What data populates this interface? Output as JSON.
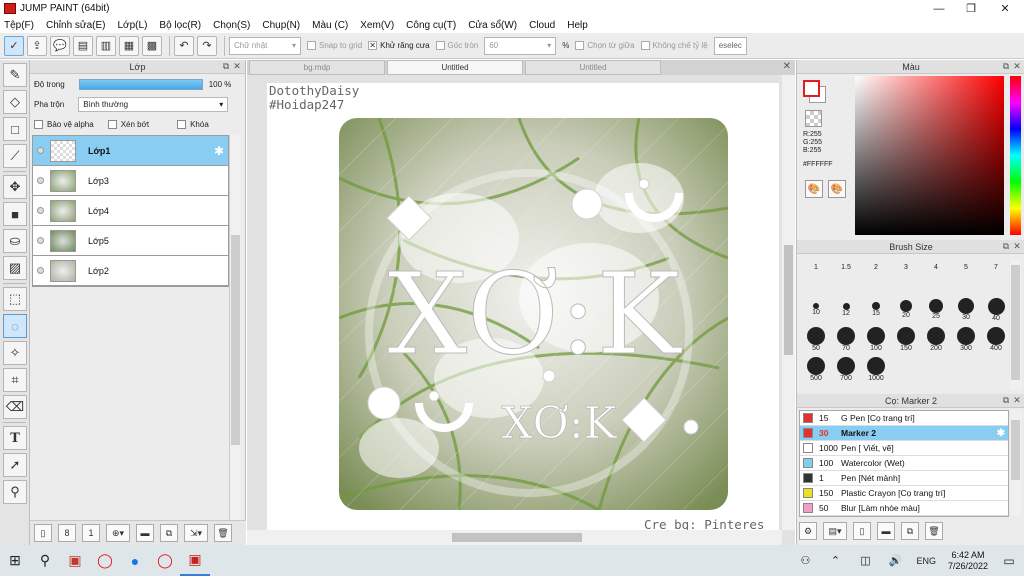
{
  "window": {
    "title": "JUMP PAINT (64bit)",
    "minimize": "—",
    "maximize": "❐",
    "close": "✕"
  },
  "menu": [
    "Tệp(F)",
    "Chỉnh sửa(E)",
    "Lớp(L)",
    "Bộ lọc(R)",
    "Chọn(S)",
    "Chụp(N)",
    "Màu (C)",
    "Xem(V)",
    "Công cụ(T)",
    "Cửa sổ(W)",
    "Cloud",
    "Help"
  ],
  "toolbar": {
    "shape_select": "Chữ nhật",
    "snap_grid": "Snap to grid",
    "antialias": "Khử răng cưa",
    "round_corner": "Góc tròn",
    "round_value": "60",
    "percent": "%",
    "select_center": "Chọn từ giữa",
    "lock_ratio": "Không chế tỷ lệ",
    "deselect": "eselec"
  },
  "layer_panel": {
    "title": "Lớp",
    "opacity_label": "Độ trong",
    "opacity_value": "100 %",
    "opacity": 1.0,
    "blend_label": "Pha trộn",
    "blend_value": "Bình thường",
    "protect_alpha": "Bảo vệ alpha",
    "clipping": "Xén bớt",
    "lock": "Khóa",
    "layers": [
      {
        "name": "Lớp1",
        "active": true
      },
      {
        "name": "Lớp3",
        "active": false
      },
      {
        "name": "Lớp4",
        "active": false
      },
      {
        "name": "Lớp5",
        "active": false
      },
      {
        "name": "Lớp2",
        "active": false
      }
    ]
  },
  "canvas": {
    "tabs": [
      {
        "label": "bg.mdp",
        "active": false
      },
      {
        "label": "Untitled",
        "active": true
      },
      {
        "label": "Untitled",
        "active": false
      }
    ],
    "watermark_line1": "DotothyDaisy",
    "watermark_line2": "#Hoidap247",
    "big_text": "XƠ:K",
    "small_text": "XƠ:K",
    "credit": "Cre bg: Pinteres"
  },
  "color_panel": {
    "title": "Màu",
    "r": "R:255",
    "g": "G:255",
    "b": "B:255",
    "hex": "#FFFFFF"
  },
  "brush_panel": {
    "title": "Brush Size",
    "sizes": [
      "1",
      "1.5",
      "2",
      "3",
      "4",
      "5",
      "7",
      "10",
      "12",
      "15",
      "20",
      "25",
      "30",
      "40",
      "50",
      "70",
      "100",
      "150",
      "200",
      "300",
      "400",
      "500",
      "700",
      "1000"
    ]
  },
  "tool_panel": {
    "title": "Cọ: Marker 2",
    "items": [
      {
        "size": "15",
        "name": "G Pen [Cọ trang trí]",
        "color": "#e03030",
        "active": false
      },
      {
        "size": "30",
        "name": "Marker 2",
        "color": "#e03030",
        "active": true
      },
      {
        "size": "1000",
        "name": "Pen [ Viết, vẽ]",
        "color": "#ffffff",
        "active": false
      },
      {
        "size": "100",
        "name": "Watercolor (Wet)",
        "color": "#7fd0f0",
        "active": false
      },
      {
        "size": "1",
        "name": "Pen [Nét mảnh]",
        "color": "#333333",
        "active": false
      },
      {
        "size": "150",
        "name": "Plastic Crayon [Cọ trang trí]",
        "color": "#e8e020",
        "active": false
      },
      {
        "size": "50",
        "name": "Blur [Làm nhòe màu]",
        "color": "#f0a0c8",
        "active": false
      }
    ]
  },
  "taskbar": {
    "time": "6:42 AM",
    "date": "7/26/2022",
    "lang": "ENG"
  }
}
